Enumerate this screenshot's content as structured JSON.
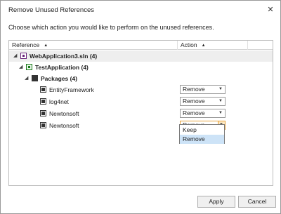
{
  "window": {
    "title": "Remove Unused References",
    "close_glyph": "✕"
  },
  "prompt": "Choose which action you would like to perform on the unused references.",
  "columns": {
    "reference": "Reference",
    "action": "Action",
    "sort_glyph": "▲"
  },
  "tree": {
    "solution": {
      "label": "WebApplication3.sln",
      "count": "(4)"
    },
    "project": {
      "label": "TestApplication",
      "count": "(4)"
    },
    "packages": {
      "label": "Packages",
      "count": "(4)"
    },
    "items": [
      {
        "label": "EntityFramework",
        "action": "Remove"
      },
      {
        "label": "log4net",
        "action": "Remove"
      },
      {
        "label": "Newtonsoft",
        "action": "Remove"
      },
      {
        "label": "Newtonsoft",
        "action": "Remove"
      }
    ],
    "expand_glyph": "◢"
  },
  "dropdown": {
    "options": [
      "Keep",
      "Remove"
    ],
    "highlighted": "Remove",
    "arrow_glyph": "▼"
  },
  "buttons": {
    "apply": "Apply",
    "cancel": "Cancel"
  }
}
